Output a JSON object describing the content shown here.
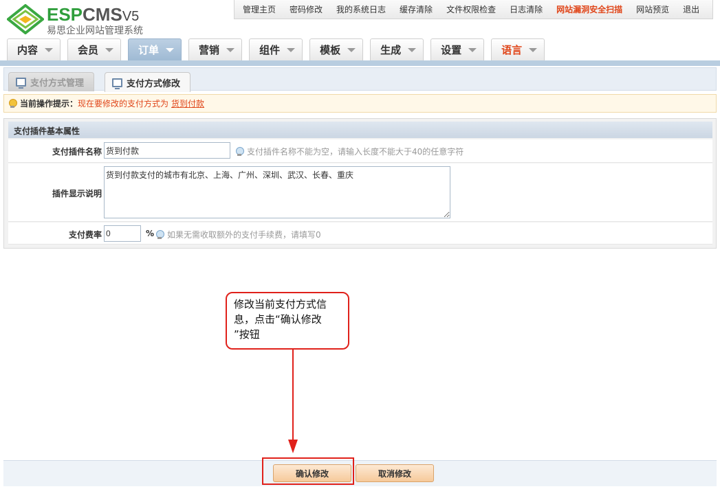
{
  "logo": {
    "brand_green": "ESP",
    "brand_dark": "CMS",
    "version": "V5",
    "subtitle": "易思企业网站管理系统"
  },
  "toplinks": [
    "管理主页",
    "密码修改",
    "我的系统日志",
    "缓存清除",
    "文件权限检查",
    "日志清除",
    "网站漏洞安全扫描",
    "网站预览",
    "退出"
  ],
  "nav": [
    "内容",
    "会员",
    "订单",
    "营销",
    "组件",
    "模板",
    "生成",
    "设置",
    "语言"
  ],
  "active_nav": "订单",
  "subtabs": {
    "manage": "支付方式管理",
    "edit": "支付方式修改"
  },
  "hint": {
    "label": "当前操作提示：",
    "text": "现在要修改的支付方式为",
    "link": "货到付款"
  },
  "panel": {
    "title": "支付插件基本属性",
    "name_label": "支付插件名称",
    "name_value": "货到付款",
    "name_tip": "支付插件名称不能为空，请输入长度不能大于40的任意字符",
    "desc_label": "插件显示说明",
    "desc_value": "货到付款支付的城市有北京、上海、广州、深圳、武汉、长春、重庆",
    "fee_label": "支付费率",
    "fee_value": "0",
    "fee_unit": "%",
    "fee_tip": "如果无需收取额外的支付手续费，请填写0"
  },
  "callout": {
    "line1": "修改当前支付方式信",
    "line2": "息，点击“确认修改",
    "line3": "”按钮"
  },
  "buttons": {
    "confirm": "确认修改",
    "cancel": "取消修改"
  },
  "colors": {
    "accent_red": "#e0201a",
    "warn_orange": "#e0461a",
    "brand_green": "#2f9e3c"
  }
}
